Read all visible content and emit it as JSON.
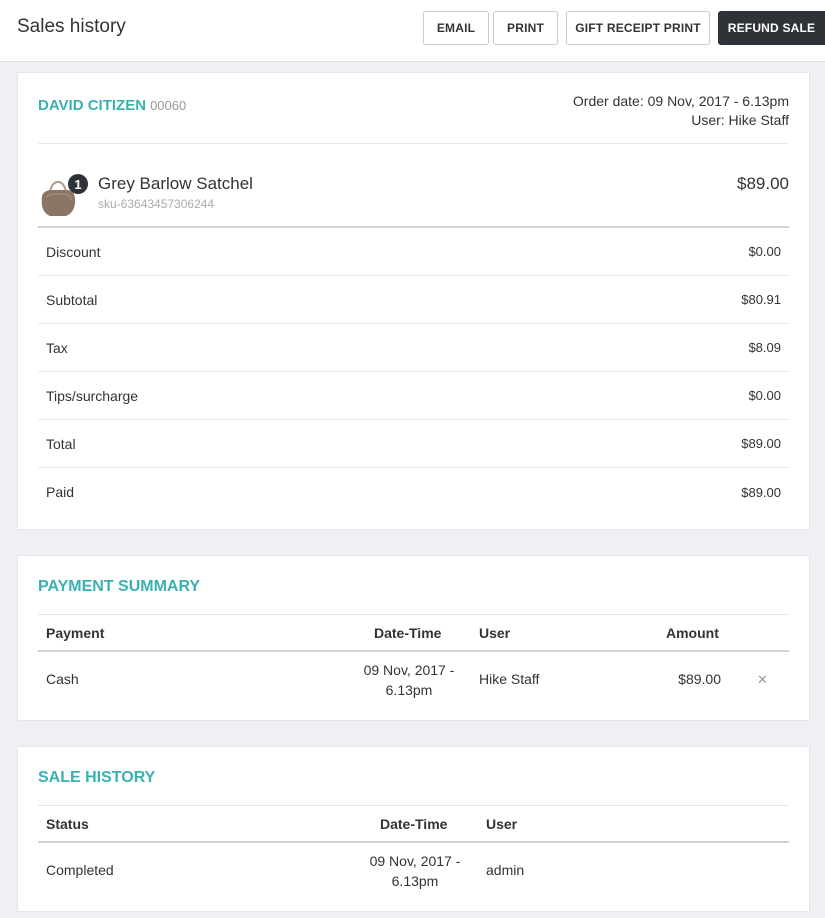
{
  "header": {
    "title": "Sales history",
    "buttons": {
      "email": "EMAIL",
      "print": "PRINT",
      "gift_receipt_print": "GIFT RECEIPT PRINT",
      "refund_sale": "REFUND SALE"
    }
  },
  "order": {
    "customer_name": "DAVID CITIZEN",
    "customer_code": "00060",
    "order_date": "Order date: 09 Nov, 2017 - 6.13pm",
    "user": "User: Hike Staff",
    "item": {
      "quantity": "1",
      "name": "Grey Barlow Satchel",
      "sku": "sku-63643457306244",
      "price": "$89.00",
      "thumbnail": "satchel-bag-image"
    },
    "summary": [
      {
        "label": "Discount",
        "value": "$0.00"
      },
      {
        "label": "Subtotal",
        "value": "$80.91"
      },
      {
        "label": "Tax",
        "value": "$8.09"
      },
      {
        "label": "Tips/surcharge",
        "value": "$0.00"
      },
      {
        "label": "Total",
        "value": "$89.00"
      },
      {
        "label": "Paid",
        "value": "$89.00"
      }
    ]
  },
  "payment_summary": {
    "title": "PAYMENT SUMMARY",
    "columns": {
      "payment": "Payment",
      "datetime": "Date-Time",
      "user": "User",
      "amount": "Amount"
    },
    "rows": [
      {
        "payment": "Cash",
        "datetime_line1": "09 Nov, 2017 -",
        "datetime_line2": "6.13pm",
        "user": "Hike Staff",
        "amount": "$89.00",
        "remove_icon": "close-icon"
      }
    ]
  },
  "sale_history": {
    "title": "SALE HISTORY",
    "columns": {
      "status": "Status",
      "datetime": "Date-Time",
      "user": "User"
    },
    "rows": [
      {
        "status": "Completed",
        "datetime_line1": "09 Nov, 2017 -",
        "datetime_line2": "6.13pm",
        "user": "admin"
      }
    ]
  },
  "colors": {
    "accent": "#3bb0b3",
    "dark_button": "#2f3338",
    "background": "#eef0f4"
  }
}
